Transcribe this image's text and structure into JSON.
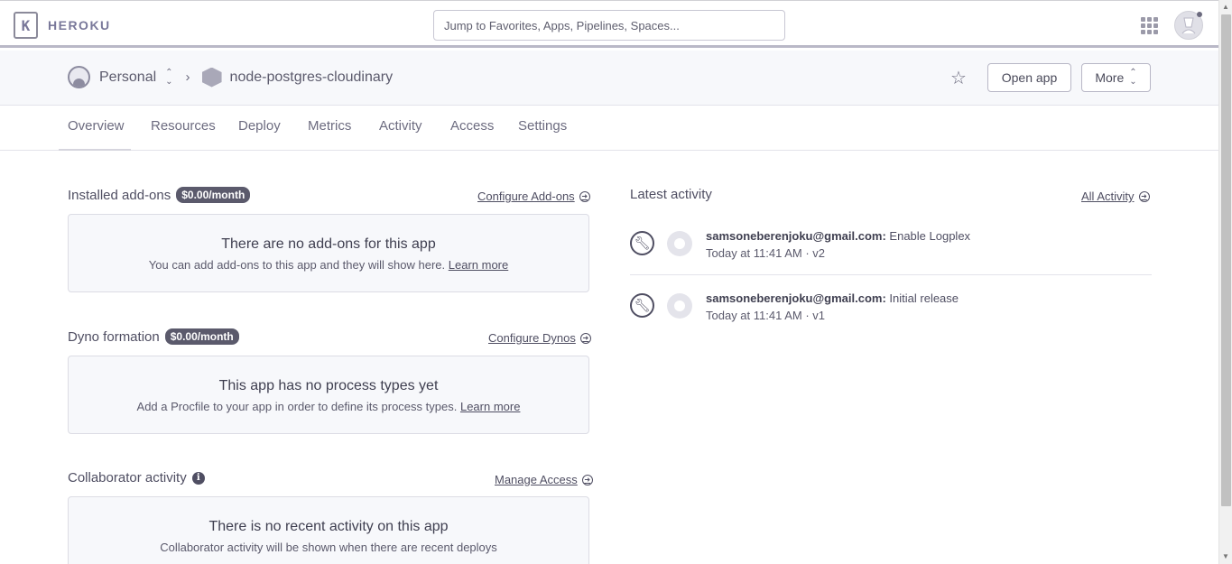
{
  "topbar": {
    "logo_glyph": "K",
    "logo_text": "HEROKU",
    "search_placeholder": "Jump to Favorites, Apps, Pipelines, Spaces..."
  },
  "app_header": {
    "account": "Personal",
    "app_name": "node-postgres-cloudinary",
    "open_app": "Open app",
    "more": "More"
  },
  "tabs": [
    "Overview",
    "Resources",
    "Deploy",
    "Metrics",
    "Activity",
    "Access",
    "Settings"
  ],
  "addons": {
    "title": "Installed add-ons",
    "badge": "$0.00/month",
    "link": "Configure Add-ons",
    "heading": "There are no add-ons for this app",
    "text": "You can add add-ons to this app and they will show here.",
    "learn": "Learn more"
  },
  "dynos": {
    "title": "Dyno formation",
    "badge": "$0.00/month",
    "link": "Configure Dynos",
    "heading": "This app has no process types yet",
    "text": "Add a Procfile to your app in order to define its process types.",
    "learn": "Learn more"
  },
  "collab": {
    "title": "Collaborator activity",
    "link": "Manage Access",
    "heading": "There is no recent activity on this app",
    "text": "Collaborator activity will be shown when there are recent deploys"
  },
  "activity": {
    "title": "Latest activity",
    "link": "All Activity",
    "items": [
      {
        "user": "samsoneberenjoku@gmail.com:",
        "action": "Enable Logplex",
        "meta": "Today at 11:41 AM · v2"
      },
      {
        "user": "samsoneberenjoku@gmail.com:",
        "action": "Initial release",
        "meta": "Today at 11:41 AM · v1"
      }
    ]
  }
}
